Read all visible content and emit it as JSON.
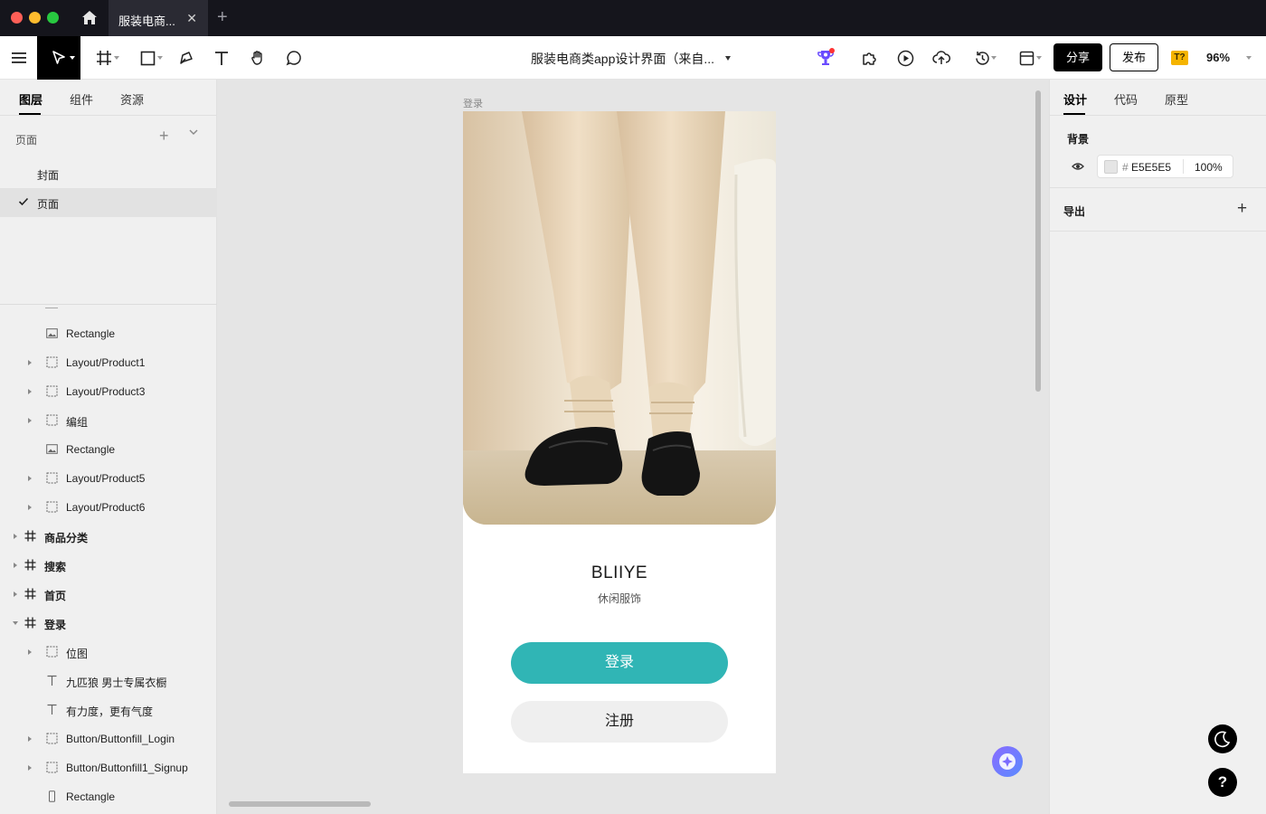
{
  "window": {
    "tab_title": "服装电商...",
    "tab_close": "✕",
    "new_tab": "+"
  },
  "toolbar": {
    "doc_title": "服装电商类app设计界面（来自...",
    "share_label": "分享",
    "publish_label": "发布",
    "font_badge": "T?",
    "zoom": "96%"
  },
  "left_panel": {
    "tabs": [
      {
        "label": "图层",
        "active": true
      },
      {
        "label": "组件",
        "active": false
      },
      {
        "label": "资源",
        "active": false
      }
    ],
    "pages_header": "页面",
    "pages": [
      {
        "label": "封面",
        "selected": false
      },
      {
        "label": "页面",
        "selected": true
      }
    ],
    "layers": [
      {
        "name": "Rectangle",
        "icon": "image-icon",
        "level": 2,
        "expand": "none"
      },
      {
        "name": "Layout/Product1",
        "icon": "component-frame-icon",
        "level": 2,
        "expand": "collapsed"
      },
      {
        "name": "Layout/Product3",
        "icon": "component-frame-icon",
        "level": 2,
        "expand": "collapsed"
      },
      {
        "name": "编组",
        "icon": "component-frame-icon",
        "level": 2,
        "expand": "collapsed"
      },
      {
        "name": "Rectangle",
        "icon": "image-icon",
        "level": 2,
        "expand": "none"
      },
      {
        "name": "Layout/Product5",
        "icon": "component-frame-icon",
        "level": 2,
        "expand": "collapsed"
      },
      {
        "name": "Layout/Product6",
        "icon": "component-frame-icon",
        "level": 2,
        "expand": "collapsed"
      },
      {
        "name": "商品分类",
        "icon": "frame-icon",
        "level": 1,
        "expand": "collapsed"
      },
      {
        "name": "搜索",
        "icon": "frame-icon",
        "level": 1,
        "expand": "collapsed"
      },
      {
        "name": "首页",
        "icon": "frame-icon",
        "level": 1,
        "expand": "collapsed"
      },
      {
        "name": "登录",
        "icon": "frame-icon",
        "level": 1,
        "expand": "expanded"
      },
      {
        "name": "位图",
        "icon": "component-frame-icon",
        "level": 2,
        "expand": "collapsed"
      },
      {
        "name": "九匹狼 男士专属衣橱",
        "icon": "text-icon",
        "level": 2,
        "expand": "none"
      },
      {
        "name": "有力度，更有气度",
        "icon": "text-icon",
        "level": 2,
        "expand": "none"
      },
      {
        "name": "Button/Buttonfill_Login",
        "icon": "component-frame-icon",
        "level": 2,
        "expand": "collapsed"
      },
      {
        "name": "Button/Buttonfill1_Signup",
        "icon": "component-frame-icon",
        "level": 2,
        "expand": "collapsed"
      },
      {
        "name": "Rectangle",
        "icon": "rectangle-icon",
        "level": 2,
        "expand": "none"
      }
    ]
  },
  "canvas": {
    "frame_label": "登录",
    "brand": "BLIIYE",
    "tagline": "休闲服饰",
    "login_label": "登录",
    "signup_label": "注册",
    "accent_color": "#30B5B5"
  },
  "right_panel": {
    "tabs": [
      {
        "label": "设计",
        "active": true
      },
      {
        "label": "代码",
        "active": false
      },
      {
        "label": "原型",
        "active": false
      }
    ],
    "background_label": "背景",
    "hash": "#",
    "background_hex": "E5E5E5",
    "background_opacity": "100%",
    "export_label": "导出",
    "export_add": "+",
    "help_label": "?"
  }
}
